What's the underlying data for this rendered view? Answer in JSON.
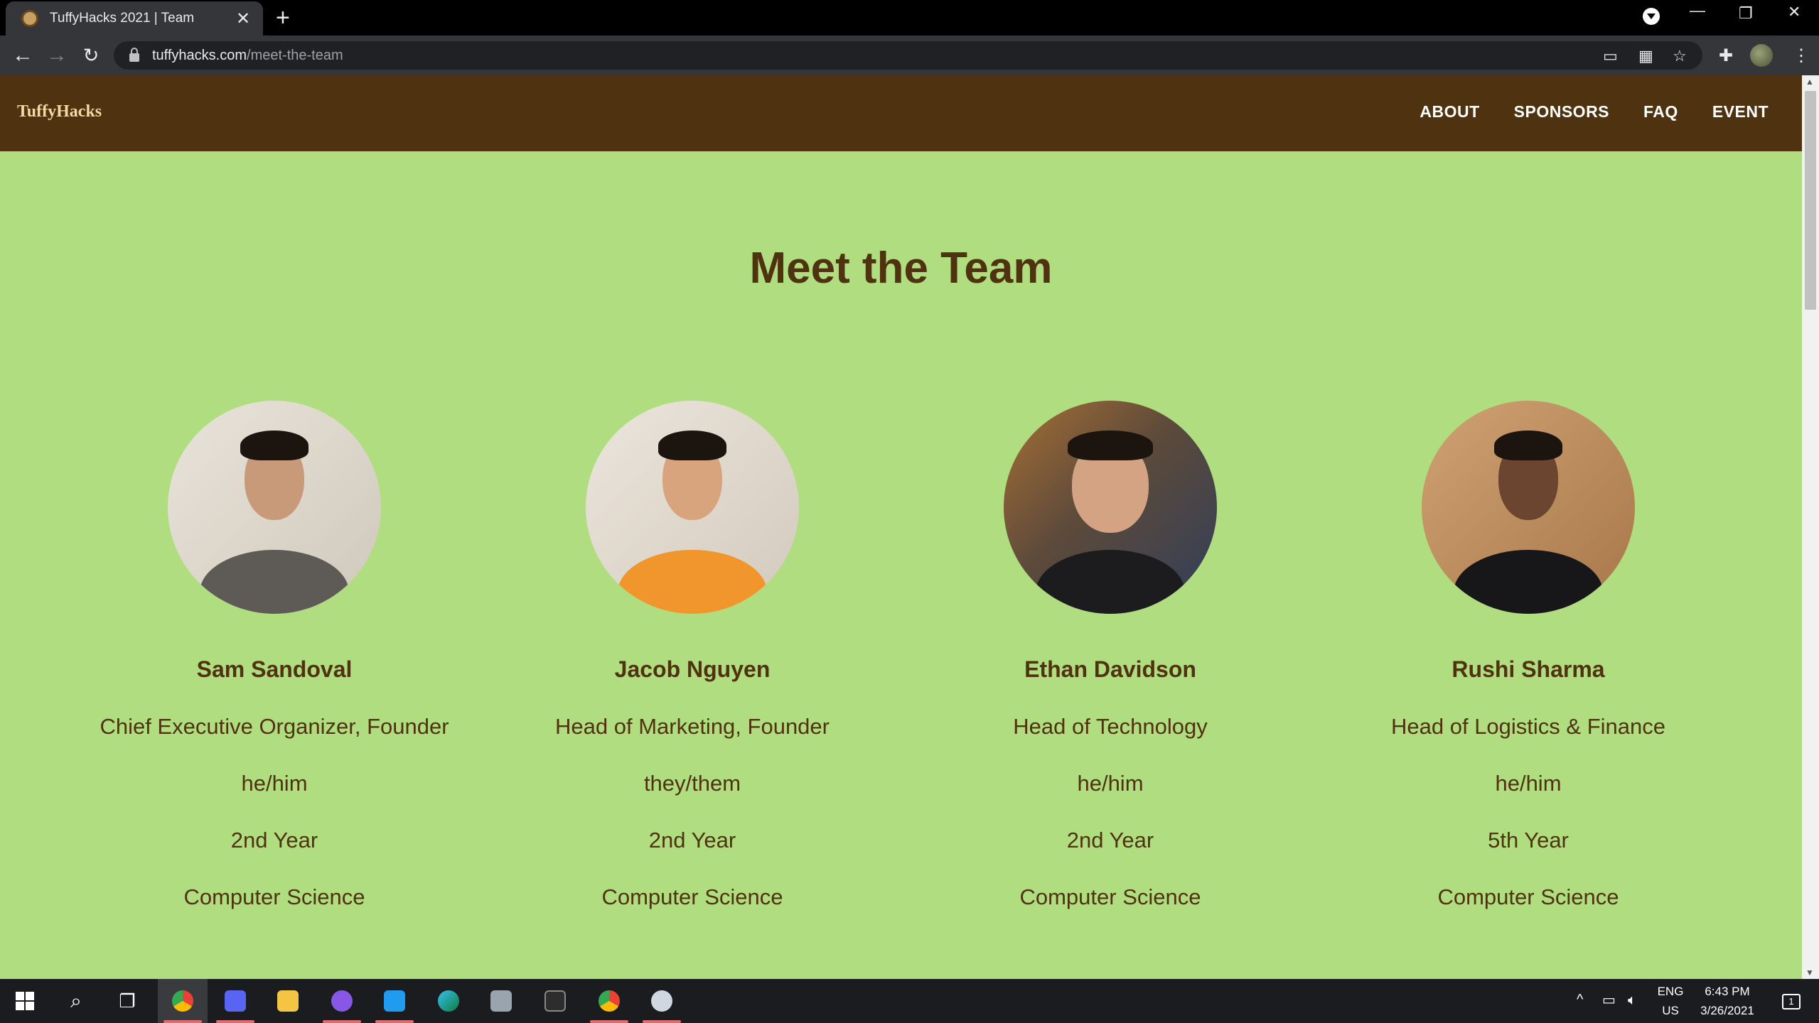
{
  "browser": {
    "tab_title": "TuffyHacks 2021 | Team",
    "tab_close": "✕",
    "new_tab": "+",
    "url_host": "tuffyhacks.com",
    "url_path": "/meet-the-team"
  },
  "site": {
    "brand": "TuffyHacks",
    "nav": [
      "ABOUT",
      "SPONSORS",
      "FAQ",
      "EVENT"
    ],
    "page_title": "Meet the Team"
  },
  "team": [
    {
      "name": "Sam Sandoval",
      "role": "Chief Executive Organizer, Founder",
      "pronouns": "he/him",
      "year": "2nd Year",
      "major": "Computer Science"
    },
    {
      "name": "Jacob Nguyen",
      "role": "Head of Marketing, Founder",
      "pronouns": "they/them",
      "year": "2nd Year",
      "major": "Computer Science"
    },
    {
      "name": "Ethan Davidson",
      "role": "Head of Technology",
      "pronouns": "he/him",
      "year": "2nd Year",
      "major": "Computer Science"
    },
    {
      "name": "Rushi Sharma",
      "role": "Head of Logistics & Finance",
      "pronouns": "he/him",
      "year": "5th Year",
      "major": "Computer Science"
    }
  ],
  "taskbar": {
    "lang_top": "ENG",
    "lang_bottom": "US",
    "time": "6:43 PM",
    "date": "3/26/2021",
    "notifications": "1"
  },
  "colors": {
    "nav_bg": "#4f3310",
    "page_bg": "#b0dd7f",
    "text": "#4f3310"
  }
}
